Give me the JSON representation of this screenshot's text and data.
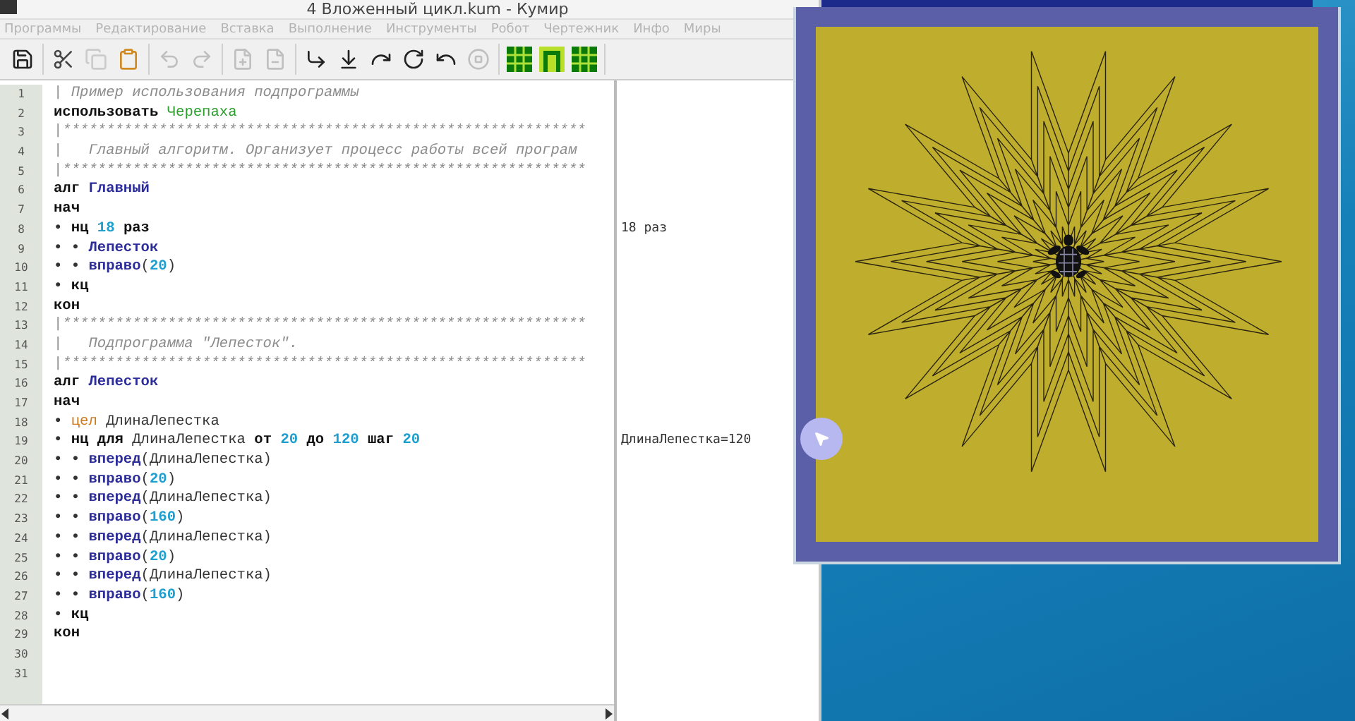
{
  "window": {
    "title": "4 Вложенный цикл.kum - Кумир"
  },
  "menu": [
    "Программы",
    "Редактирование",
    "Вставка",
    "Выполнение",
    "Инструменты",
    "Робот",
    "Чертежник",
    "Инфо",
    "Миры"
  ],
  "toolbar": [
    {
      "buttons": [
        {
          "kind": "save",
          "disabled": false
        }
      ]
    },
    {
      "buttons": [
        {
          "kind": "cut",
          "disabled": false
        },
        {
          "kind": "copy",
          "disabled": true
        },
        {
          "kind": "paste",
          "disabled": false
        }
      ]
    },
    {
      "buttons": [
        {
          "kind": "undo",
          "disabled": true
        },
        {
          "kind": "redo",
          "disabled": true
        }
      ]
    },
    {
      "buttons": [
        {
          "kind": "comment",
          "disabled": true
        },
        {
          "kind": "uncomment",
          "disabled": true
        }
      ]
    },
    {
      "buttons": [
        {
          "kind": "run",
          "disabled": false
        },
        {
          "kind": "step",
          "disabled": false
        },
        {
          "kind": "step-over",
          "disabled": false
        },
        {
          "kind": "step-in",
          "disabled": false
        },
        {
          "kind": "step-out",
          "disabled": false
        },
        {
          "kind": "stop",
          "disabled": true
        }
      ]
    },
    {
      "buttons": [
        {
          "kind": "grid",
          "disabled": false
        },
        {
          "kind": "frame",
          "disabled": false
        },
        {
          "kind": "grid",
          "disabled": false
        }
      ]
    }
  ],
  "editor": {
    "lines": [
      {
        "number": "1",
        "tokens": [
          {
            "kind": "comment",
            "text": "| Пример использования подпрограммы"
          }
        ]
      },
      {
        "number": "2",
        "tokens": [
          {
            "kind": "keyword",
            "text": "использовать "
          },
          {
            "kind": "module",
            "text": "Черепаха"
          }
        ]
      },
      {
        "number": "3",
        "tokens": [
          {
            "kind": "comment",
            "text": "|************************************************************"
          }
        ]
      },
      {
        "number": "4",
        "tokens": [
          {
            "kind": "comment",
            "text": "|   Главный алгоритм. Организует процесс работы всей програм"
          }
        ]
      },
      {
        "number": "5",
        "tokens": [
          {
            "kind": "comment",
            "text": "|************************************************************"
          }
        ]
      },
      {
        "number": "6",
        "tokens": [
          {
            "kind": "keyword",
            "text": "алг "
          },
          {
            "kind": "name",
            "text": "Главный"
          }
        ]
      },
      {
        "number": "7",
        "tokens": [
          {
            "kind": "keyword",
            "text": "нач"
          }
        ]
      },
      {
        "number": "8",
        "tokens": [
          {
            "kind": "dot",
            "text": "• "
          },
          {
            "kind": "keyword",
            "text": "нц "
          },
          {
            "kind": "number",
            "text": "18"
          },
          {
            "kind": "keyword",
            "text": " раз"
          }
        ],
        "margin": "18 раз"
      },
      {
        "number": "9",
        "tokens": [
          {
            "kind": "dot",
            "text": "• • "
          },
          {
            "kind": "name",
            "text": "Лепесток"
          }
        ]
      },
      {
        "number": "10",
        "tokens": [
          {
            "kind": "dot",
            "text": "• • "
          },
          {
            "kind": "name",
            "text": "вправо"
          },
          {
            "kind": "plain",
            "text": "("
          },
          {
            "kind": "number",
            "text": "20"
          },
          {
            "kind": "plain",
            "text": ")"
          }
        ]
      },
      {
        "number": "11",
        "tokens": [
          {
            "kind": "dot",
            "text": "• "
          },
          {
            "kind": "keyword",
            "text": "кц"
          }
        ]
      },
      {
        "number": "12",
        "tokens": [
          {
            "kind": "keyword",
            "text": "кон"
          }
        ]
      },
      {
        "number": "13",
        "tokens": [
          {
            "kind": "comment",
            "text": "|************************************************************"
          }
        ]
      },
      {
        "number": "14",
        "tokens": [
          {
            "kind": "comment",
            "text": "|   Подпрограмма \"Лепесток\"."
          }
        ]
      },
      {
        "number": "15",
        "tokens": [
          {
            "kind": "comment",
            "text": "|************************************************************"
          }
        ]
      },
      {
        "number": "16",
        "tokens": [
          {
            "kind": "keyword",
            "text": "алг "
          },
          {
            "kind": "name",
            "text": "Лепесток"
          }
        ]
      },
      {
        "number": "17",
        "tokens": [
          {
            "kind": "keyword",
            "text": "нач"
          }
        ]
      },
      {
        "number": "18",
        "tokens": [
          {
            "kind": "dot",
            "text": "• "
          },
          {
            "kind": "type",
            "text": "цел"
          },
          {
            "kind": "plain",
            "text": " ДлинаЛепестка"
          }
        ]
      },
      {
        "number": "19",
        "tokens": [
          {
            "kind": "dot",
            "text": "• "
          },
          {
            "kind": "keyword",
            "text": "нц для "
          },
          {
            "kind": "plain",
            "text": "ДлинаЛепестка"
          },
          {
            "kind": "keyword",
            "text": " от "
          },
          {
            "kind": "number",
            "text": "20"
          },
          {
            "kind": "keyword",
            "text": " до "
          },
          {
            "kind": "number",
            "text": "120"
          },
          {
            "kind": "keyword",
            "text": " шаг "
          },
          {
            "kind": "number",
            "text": "20"
          }
        ],
        "margin": "ДлинаЛепестка=120"
      },
      {
        "number": "20",
        "tokens": [
          {
            "kind": "dot",
            "text": "• • "
          },
          {
            "kind": "name",
            "text": "вперед"
          },
          {
            "kind": "plain",
            "text": "(ДлинаЛепестка)"
          }
        ]
      },
      {
        "number": "21",
        "tokens": [
          {
            "kind": "dot",
            "text": "• • "
          },
          {
            "kind": "name",
            "text": "вправо"
          },
          {
            "kind": "plain",
            "text": "("
          },
          {
            "kind": "number",
            "text": "20"
          },
          {
            "kind": "plain",
            "text": ")"
          }
        ]
      },
      {
        "number": "22",
        "tokens": [
          {
            "kind": "dot",
            "text": "• • "
          },
          {
            "kind": "name",
            "text": "вперед"
          },
          {
            "kind": "plain",
            "text": "(ДлинаЛепестка)"
          }
        ]
      },
      {
        "number": "23",
        "tokens": [
          {
            "kind": "dot",
            "text": "• • "
          },
          {
            "kind": "name",
            "text": "вправо"
          },
          {
            "kind": "plain",
            "text": "("
          },
          {
            "kind": "number",
            "text": "160"
          },
          {
            "kind": "plain",
            "text": ")"
          }
        ]
      },
      {
        "number": "24",
        "tokens": [
          {
            "kind": "dot",
            "text": "• • "
          },
          {
            "kind": "name",
            "text": "вперед"
          },
          {
            "kind": "plain",
            "text": "(ДлинаЛепестка)"
          }
        ]
      },
      {
        "number": "25",
        "tokens": [
          {
            "kind": "dot",
            "text": "• • "
          },
          {
            "kind": "name",
            "text": "вправо"
          },
          {
            "kind": "plain",
            "text": "("
          },
          {
            "kind": "number",
            "text": "20"
          },
          {
            "kind": "plain",
            "text": ")"
          }
        ]
      },
      {
        "number": "26",
        "tokens": [
          {
            "kind": "dot",
            "text": "• • "
          },
          {
            "kind": "name",
            "text": "вперед"
          },
          {
            "kind": "plain",
            "text": "(ДлинаЛепестка)"
          }
        ]
      },
      {
        "number": "27",
        "tokens": [
          {
            "kind": "dot",
            "text": "• • "
          },
          {
            "kind": "name",
            "text": "вправо"
          },
          {
            "kind": "plain",
            "text": "("
          },
          {
            "kind": "number",
            "text": "160"
          },
          {
            "kind": "plain",
            "text": ")"
          }
        ]
      },
      {
        "number": "28",
        "tokens": [
          {
            "kind": "dot",
            "text": "• "
          },
          {
            "kind": "keyword",
            "text": "кц"
          }
        ]
      },
      {
        "number": "29",
        "tokens": [
          {
            "kind": "keyword",
            "text": "кон"
          }
        ]
      },
      {
        "number": "30"
      },
      {
        "number": "31"
      }
    ]
  }
}
